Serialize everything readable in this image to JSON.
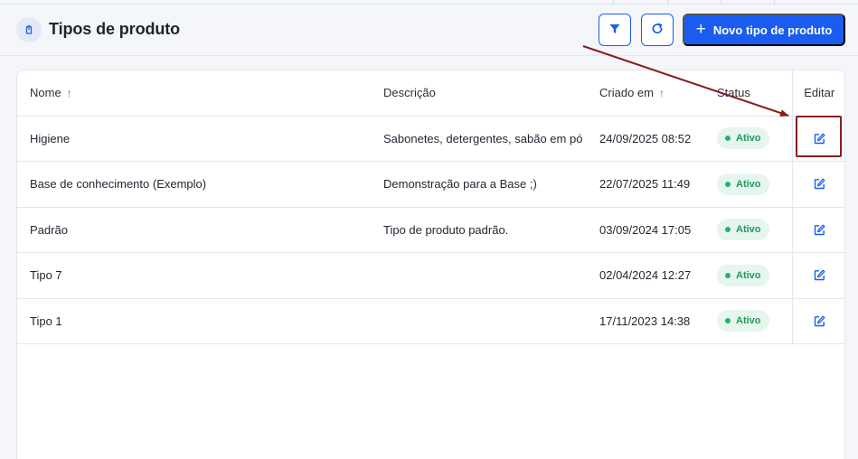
{
  "header": {
    "title": "Tipos de produto",
    "new_button_label": "Novo tipo de produto"
  },
  "table": {
    "columns": {
      "nome": "Nome",
      "descricao": "Descrição",
      "criado_em": "Criado em",
      "status": "Status",
      "editar": "Editar"
    },
    "rows": [
      {
        "nome": "Higiene",
        "descricao": "Sabonetes, detergentes, sabão em pó",
        "criado_em": "24/09/2025 08:52",
        "status": "Ativo"
      },
      {
        "nome": "Base de conhecimento (Exemplo)",
        "descricao": "Demonstração para a Base ;)",
        "criado_em": "22/07/2025 11:49",
        "status": "Ativo"
      },
      {
        "nome": "Padrão",
        "descricao": "Tipo de produto padrão.",
        "criado_em": "03/09/2024 17:05",
        "status": "Ativo"
      },
      {
        "nome": "Tipo 7",
        "descricao": "",
        "criado_em": "02/04/2024 12:27",
        "status": "Ativo"
      },
      {
        "nome": "Tipo 1",
        "descricao": "",
        "criado_em": "17/11/2023 14:38",
        "status": "Ativo"
      }
    ]
  },
  "icons": {
    "title": "tag-icon",
    "filter": "filter-icon",
    "refresh": "refresh-icon",
    "add": "plus-icon",
    "sort": "arrow-up-icon",
    "edit": "edit-icon"
  },
  "colors": {
    "primary": "#1a5cf0",
    "status_bg": "#e6f6ee",
    "status_text": "#1f9a5c",
    "annotation": "#8a1c1c"
  }
}
